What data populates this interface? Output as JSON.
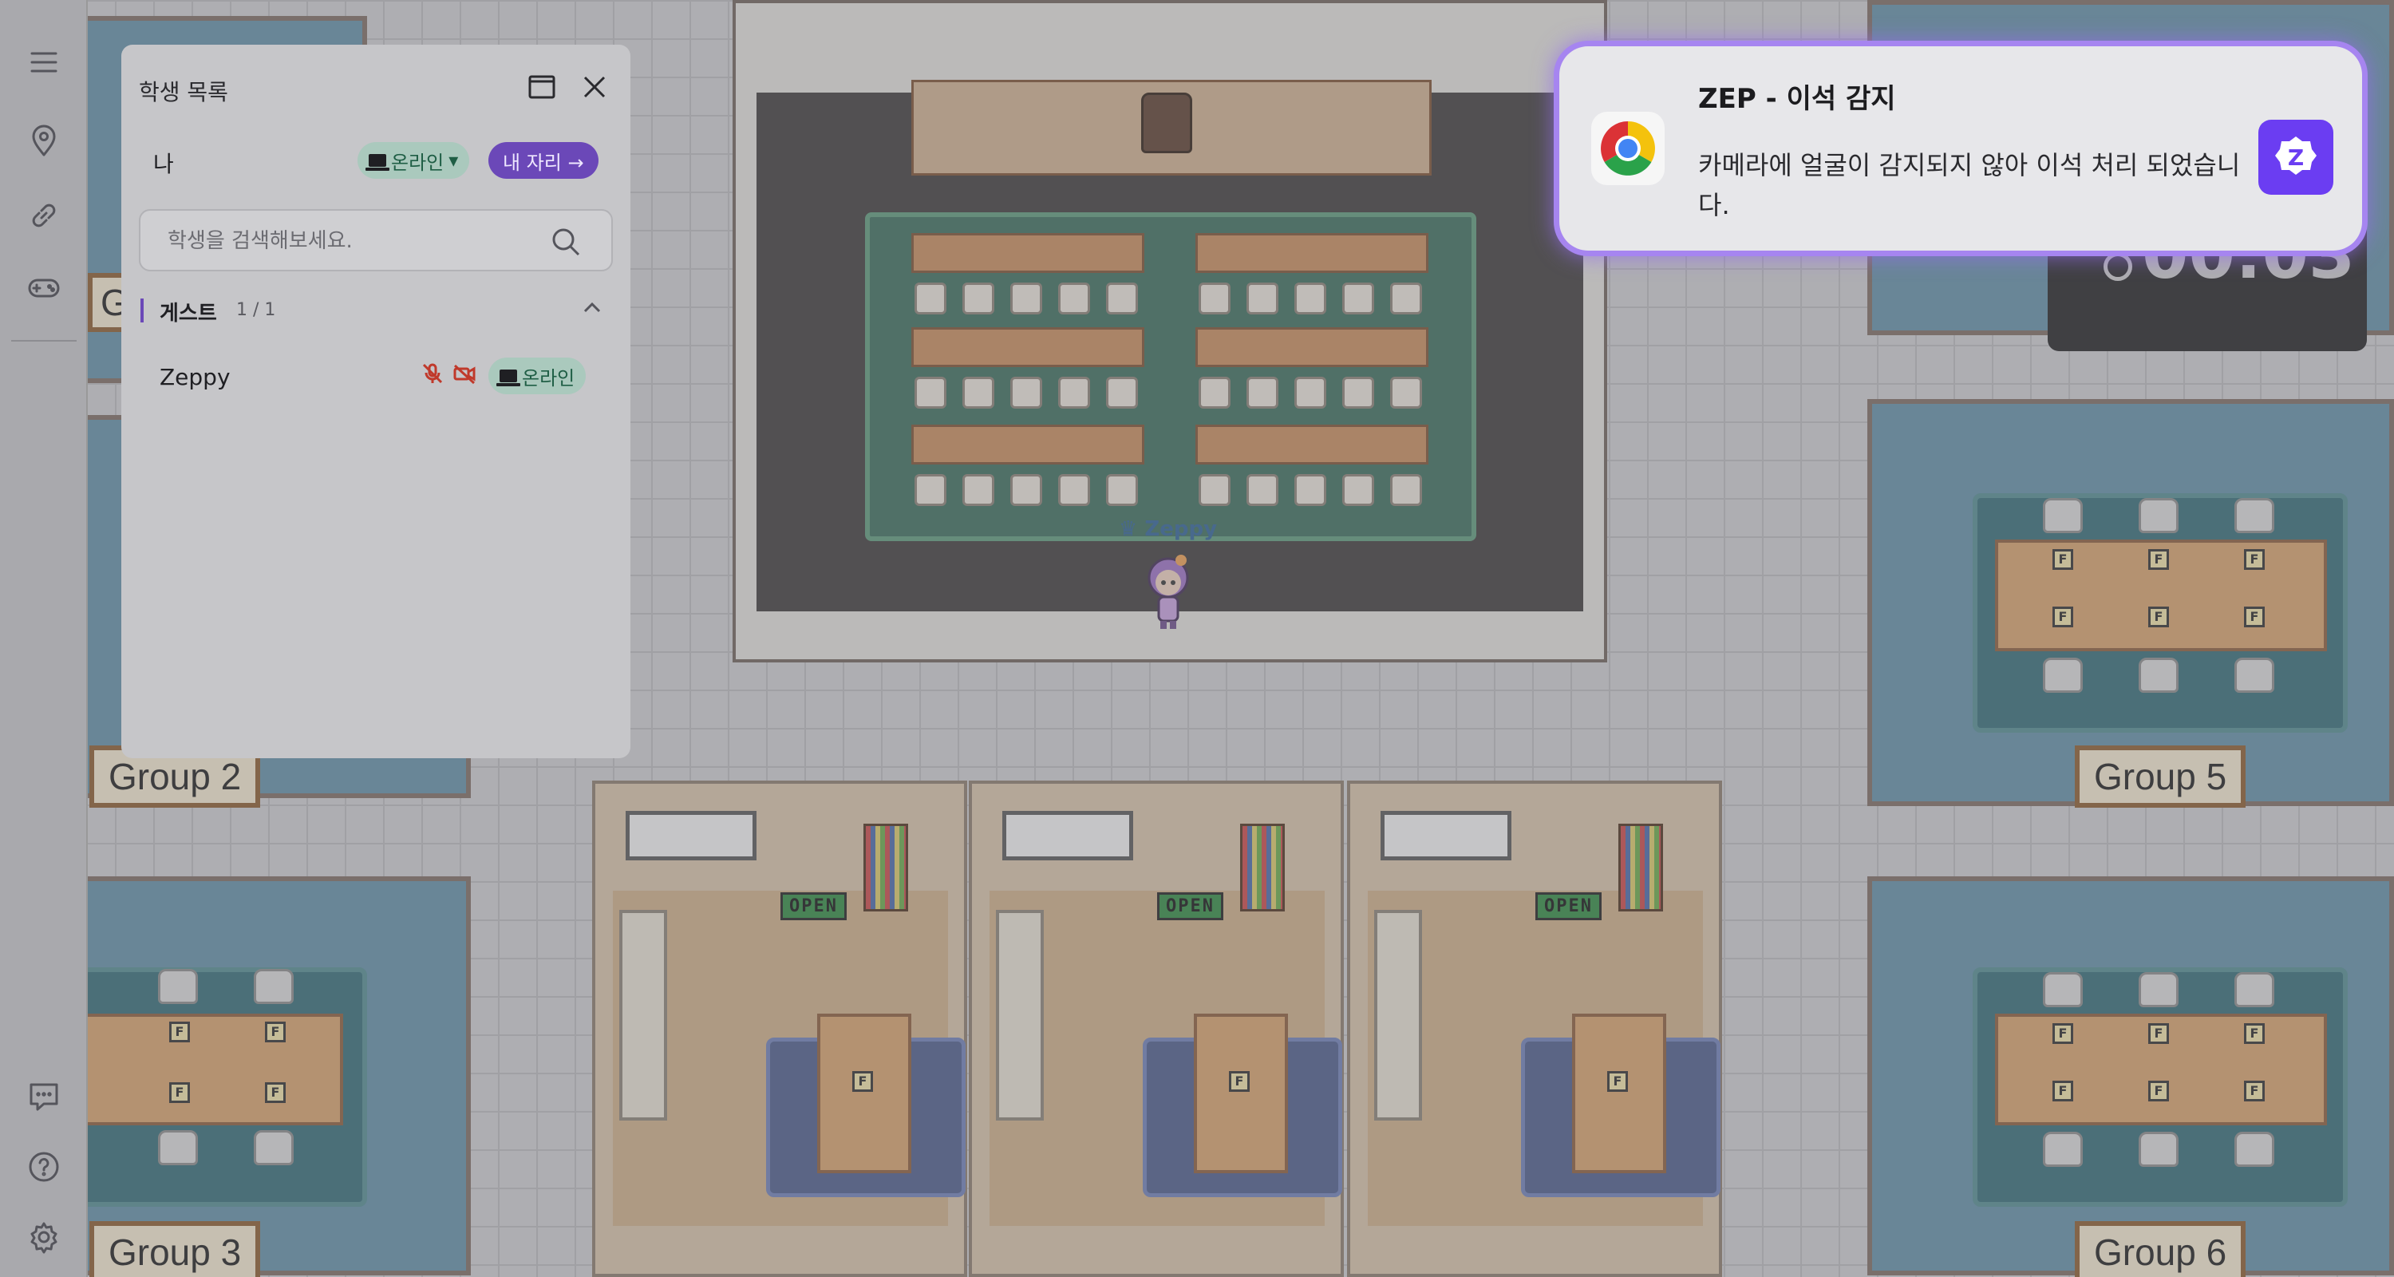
{
  "app": {
    "brand_color": "#6b3df2",
    "accent": "#6b48b8",
    "online_color": "#1f5e45"
  },
  "rail": {
    "icons": [
      "menu-icon",
      "location-pin-icon",
      "link-icon",
      "gamepad-icon",
      "chat-icon",
      "help-icon",
      "settings-icon"
    ]
  },
  "panel": {
    "title": "학생 목록",
    "me_label": "나",
    "my_status": "온라인",
    "my_seat_button": "내 자리 →",
    "search_placeholder": "학생을 검색해보세요.",
    "guest_section": {
      "title": "게스트",
      "count": "1 / 1"
    },
    "students": [
      {
        "name": "Zeppy",
        "status": "온라인",
        "mic": "off",
        "camera": "off"
      }
    ]
  },
  "notification": {
    "source_icon": "chrome-icon",
    "title": "ZEP - 이석 감지",
    "message": "카메라에 얼굴이 감지되지 않아 이석 처리 되었습니다.",
    "app_icon": "zep-icon",
    "glow_color": "#a685f0"
  },
  "map": {
    "avatar_name": "Zeppy",
    "group_labels": [
      "Group 2",
      "Group 3",
      "Group 5",
      "Group 6"
    ],
    "partial_label": "G",
    "open_sign": "OPEN",
    "desk_sign": "F",
    "timer_text": "00:03"
  }
}
